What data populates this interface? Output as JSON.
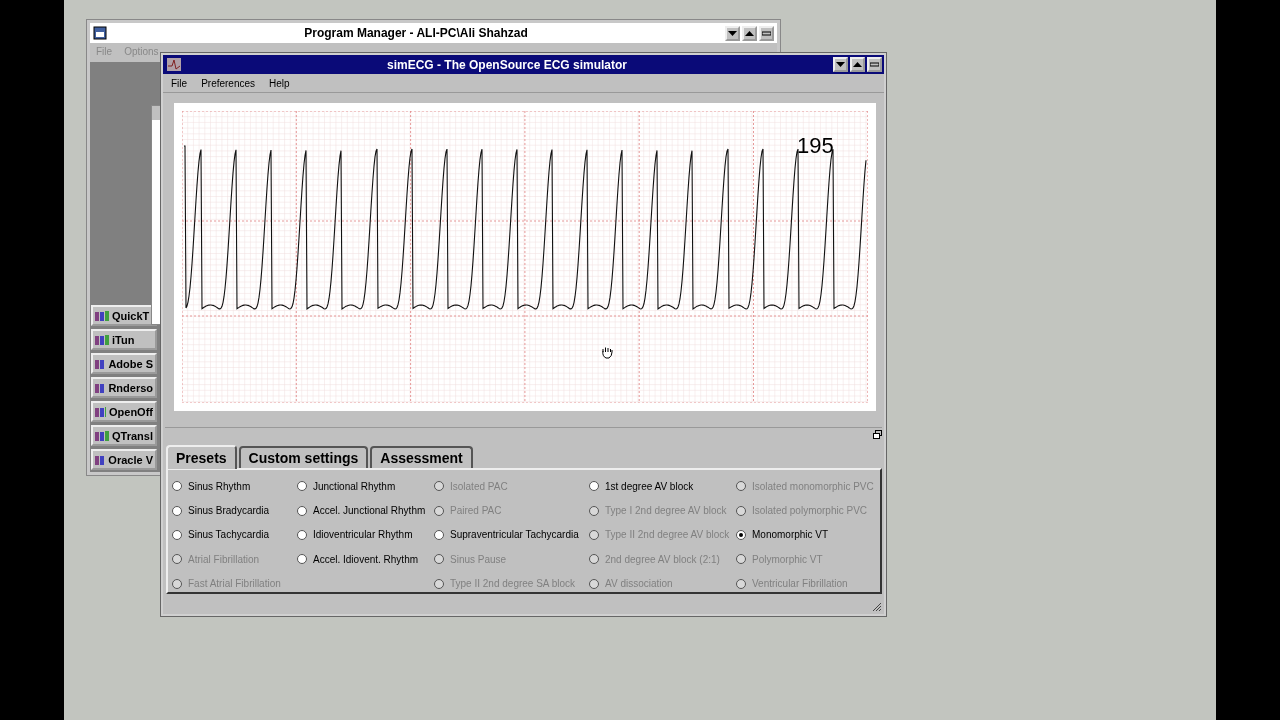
{
  "program_manager": {
    "title": "Program Manager - ALI-PC\\Ali Shahzad",
    "menu": [
      {
        "label": "File",
        "disabled": true
      },
      {
        "label": "Options",
        "disabled": true
      }
    ],
    "groups": [
      "QuickT",
      "iTun",
      "Adobe S",
      "Rnderso",
      "OpenOff",
      "QTransl",
      "Oracle V"
    ]
  },
  "simecg": {
    "title": "simECG - The OpenSource ECG simulator",
    "menu": [
      "File",
      "Preferences",
      "Help"
    ],
    "heart_rate": "195",
    "tabs": [
      {
        "label": "Presets",
        "selected": true
      },
      {
        "label": "Custom settings",
        "selected": false
      },
      {
        "label": "Assessment",
        "selected": false
      }
    ],
    "preset_columns": [
      [
        {
          "label": "Sinus Rhythm",
          "disabled": false,
          "selected": false
        },
        {
          "label": "Sinus Bradycardia",
          "disabled": false,
          "selected": false
        },
        {
          "label": "Sinus Tachycardia",
          "disabled": false,
          "selected": false
        },
        {
          "label": "Atrial Fibrillation",
          "disabled": true,
          "selected": false
        },
        {
          "label": "Fast Atrial Fibrillation",
          "disabled": true,
          "selected": false
        }
      ],
      [
        {
          "label": "Junctional Rhythm",
          "disabled": false,
          "selected": false
        },
        {
          "label": "Accel. Junctional Rhythm",
          "disabled": false,
          "selected": false
        },
        {
          "label": "Idioventricular Rhythm",
          "disabled": false,
          "selected": false
        },
        {
          "label": "Accel. Idiovent. Rhythm",
          "disabled": false,
          "selected": false
        }
      ],
      [
        {
          "label": "Isolated PAC",
          "disabled": true,
          "selected": false
        },
        {
          "label": "Paired PAC",
          "disabled": true,
          "selected": false
        },
        {
          "label": "Supraventricular Tachycardia",
          "disabled": false,
          "selected": false
        },
        {
          "label": "Sinus Pause",
          "disabled": true,
          "selected": false
        },
        {
          "label": "Type II 2nd degree SA block",
          "disabled": true,
          "selected": false
        }
      ],
      [
        {
          "label": "1st degree AV block",
          "disabled": false,
          "selected": false
        },
        {
          "label": "Type I 2nd degree AV block",
          "disabled": true,
          "selected": false
        },
        {
          "label": "Type II 2nd degree AV block",
          "disabled": true,
          "selected": false
        },
        {
          "label": "2nd degree AV block (2:1)",
          "disabled": true,
          "selected": false
        },
        {
          "label": "AV dissociation",
          "disabled": true,
          "selected": false
        }
      ],
      [
        {
          "label": "Isolated monomorphic PVC",
          "disabled": true,
          "selected": false
        },
        {
          "label": "Isolated polymorphic PVC",
          "disabled": true,
          "selected": false
        },
        {
          "label": "Monomorphic VT",
          "disabled": false,
          "selected": true
        },
        {
          "label": "Polymorphic VT",
          "disabled": true,
          "selected": false
        },
        {
          "label": "Ventricular Fibrillation",
          "disabled": true,
          "selected": false
        }
      ]
    ]
  }
}
